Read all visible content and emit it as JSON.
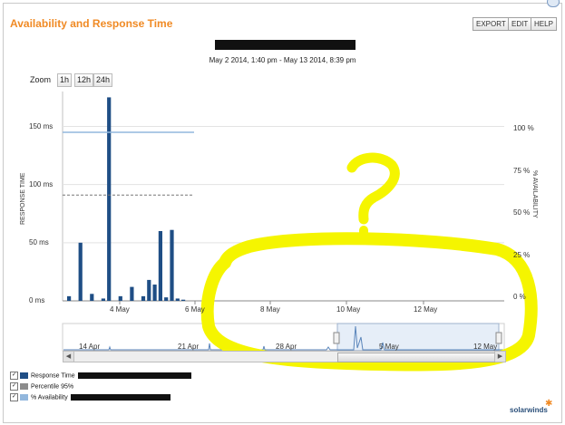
{
  "window": {
    "title": "Availability and Response Time",
    "buttons": [
      "EXPORT",
      "EDIT",
      "HELP"
    ],
    "date_range": "May 2 2014, 1:40 pm - May 13 2014, 8:39 pm"
  },
  "zoom": {
    "label": "Zoom",
    "options": [
      "1h",
      "12h",
      "24h"
    ]
  },
  "chart_data": {
    "type": "bar",
    "ylabel": "RESPONSE TIME",
    "ylabel_right": "% AVAILABILITY",
    "y_ticks": [
      "0 ms",
      "50 ms",
      "100 ms",
      "150 ms"
    ],
    "y_right_ticks": [
      "0 %",
      "25 %",
      "50 %",
      "75 %",
      "100 %"
    ],
    "x_ticks": [
      "4 May",
      "6 May",
      "8 May",
      "10 May",
      "12 May"
    ],
    "ylim": [
      0,
      180
    ],
    "response_time_ms": [
      4,
      0,
      50,
      0,
      6,
      0,
      2,
      175,
      0,
      4,
      0,
      12,
      0,
      4,
      18,
      14,
      60,
      3,
      61,
      2,
      1,
      0,
      0
    ],
    "percentile_95_ms": 91,
    "availability_pct": 100,
    "grid": true
  },
  "navigator": {
    "x_ticks": [
      "14 Apr",
      "21 Apr",
      "28 Apr",
      "5 May",
      "12 May"
    ]
  },
  "legend": [
    {
      "label": "Response Time",
      "color": "#1f4e85"
    },
    {
      "label": "Percentile 95%",
      "color": "#8c8c8c"
    },
    {
      "label": "% Availability",
      "color": "#92b7dd"
    }
  ],
  "brand": {
    "name": "solarwinds"
  },
  "colors": {
    "accent": "#f08a24",
    "bar": "#1f4e85",
    "annotation": "#f5f500"
  }
}
